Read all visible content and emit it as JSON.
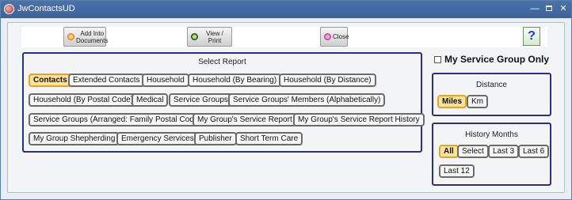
{
  "window": {
    "title": "JwContactsUD",
    "minimize_glyph": "—",
    "close_glyph": "✕"
  },
  "toolbar": {
    "add_into_documents_line1": "Add Into",
    "add_into_documents_line2": "Documents",
    "view_print": "View / Print",
    "close": "Close",
    "help": "?"
  },
  "select_report": {
    "title": "Select Report",
    "buttons": [
      "Contacts",
      "Extended Contacts",
      "Household",
      "Household (By Bearing)",
      "Household (By Distance)",
      "Household (By Postal Code)",
      "Medical",
      "Service Groups",
      "Service Groups' Members (Alphabetically)",
      "Service Groups (Arranged: Family Postal Code)",
      "My Group's Service Report",
      "My Group's Service Report History",
      "My Group Shepherding",
      "Emergency Services",
      "Publisher",
      "Short Term Care"
    ],
    "selected": "Contacts"
  },
  "my_service_group_only": {
    "label": "My Service Group Only",
    "checked": false
  },
  "distance": {
    "title": "Distance",
    "options": [
      "Miles",
      "Km"
    ],
    "selected": "Miles"
  },
  "history_months": {
    "title": "History Months",
    "options": [
      "All",
      "Select",
      "Last 3",
      "Last 6",
      "Last 12"
    ],
    "selected": "All"
  },
  "colors": {
    "selected_fill": "#ffe39a",
    "selected_border": "#e0a52d",
    "panel_border": "#2f2d86",
    "titlebar": "#3b6299"
  }
}
